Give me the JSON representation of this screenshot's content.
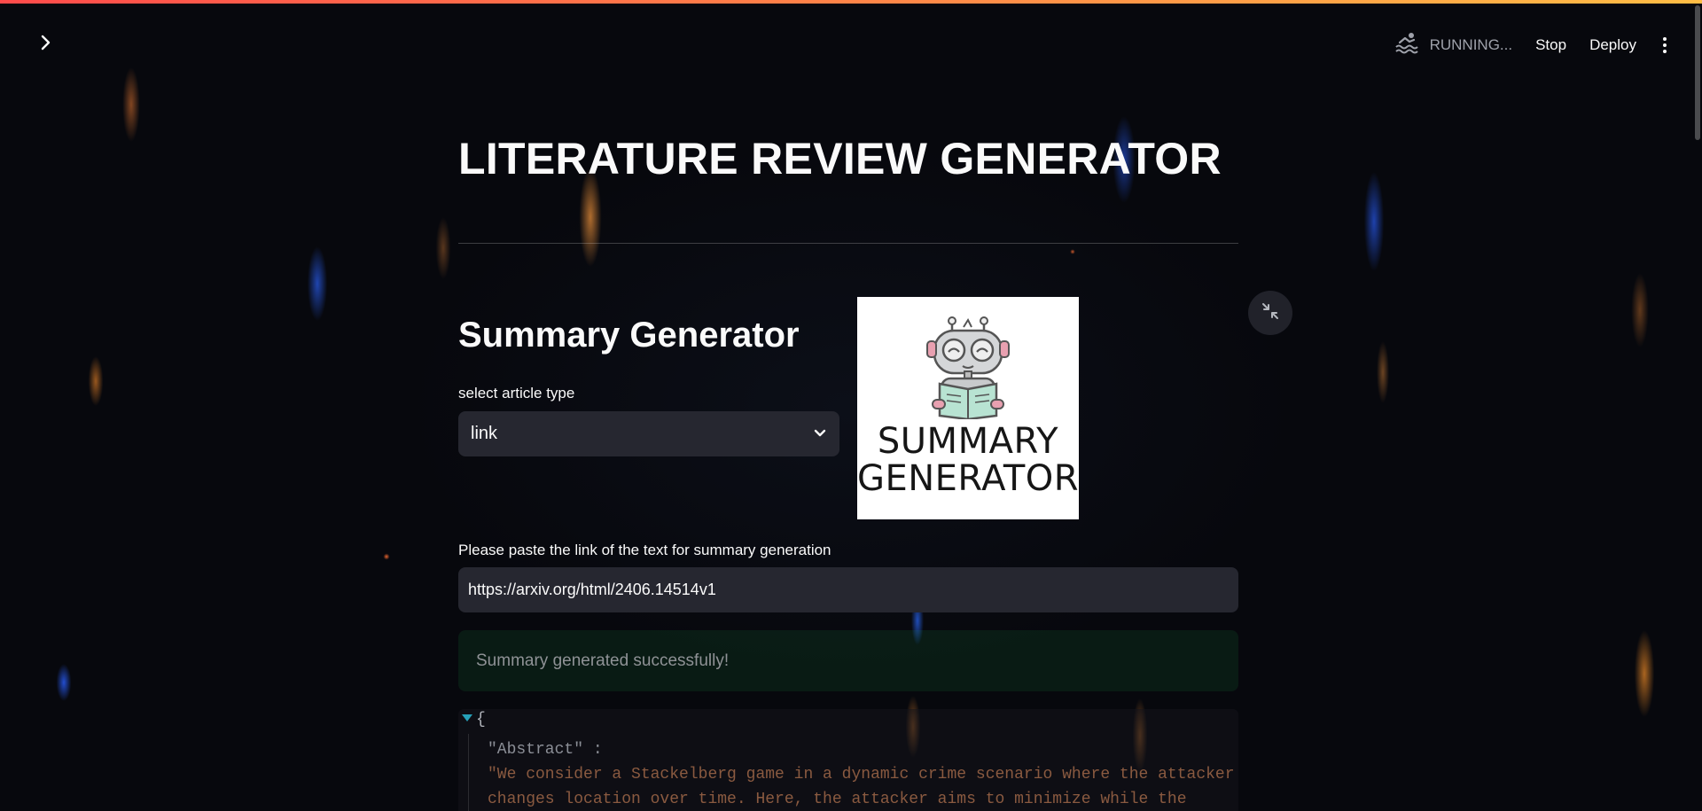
{
  "header": {
    "status_text": "RUNNING...",
    "stop_label": "Stop",
    "deploy_label": "Deploy",
    "icons": {
      "sidebar_toggle": "chevron-right-icon",
      "status": "swimmer-icon",
      "menu": "kebab-menu-icon"
    }
  },
  "main": {
    "title": "LITERATURE REVIEW GENERATOR",
    "subtitle": "Summary Generator",
    "select_label": "select article type",
    "select_value": "link",
    "logo_line1": "SUMMARY",
    "logo_line2": "GENERATOR",
    "link_label": "Please paste the link of the text for summary generation",
    "link_value": "https://arxiv.org/html/2406.14514v1",
    "success_message": "Summary generated successfully!"
  },
  "json_output": {
    "brace": "{",
    "key": "\"Abstract\" :",
    "value_line1": "\"We consider a Stackelberg game in a dynamic crime scenario where the attacker",
    "value_line2": "changes location over time. Here, the attacker aims to minimize while the"
  },
  "colors": {
    "accent_gradient_start": "#ff4b4b",
    "accent_gradient_end": "#ffbd45",
    "input_bg": "#262730",
    "success_bg": "#21c354"
  }
}
